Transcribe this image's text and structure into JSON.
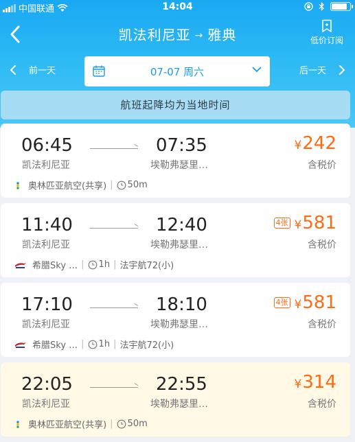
{
  "status": {
    "carrier": "中国联通",
    "time": "14:04"
  },
  "nav": {
    "from": "凯法利尼亚",
    "arrow": "→",
    "to": "雅典",
    "subscribe_label": "低价订阅"
  },
  "date_bar": {
    "prev_label": "前一天",
    "next_label": "后一天",
    "current_date": "07-07 周六"
  },
  "notice": "航班起降均为当地时间",
  "flights": [
    {
      "dep_time": "06:45",
      "arr_time": "07:35",
      "dep_city": "凯法利尼亚",
      "arr_city": "埃勒弗瑟里…",
      "price": "242",
      "currency": "¥",
      "tax_note": "含税价",
      "seats_left": "",
      "airline": "奥林匹亚航空(共享)",
      "duration": "50m",
      "aircraft": "",
      "logo": "olympic-logo"
    },
    {
      "dep_time": "11:40",
      "arr_time": "12:40",
      "dep_city": "凯法利尼亚",
      "arr_city": "埃勒弗瑟里…",
      "price": "581",
      "currency": "¥",
      "tax_note": "含税价",
      "seats_left": "4张",
      "airline": "希腊Sky …",
      "duration": "1h",
      "aircraft": "法宇航72(小)",
      "logo": "skyexpress-logo"
    },
    {
      "dep_time": "17:10",
      "arr_time": "18:10",
      "dep_city": "凯法利尼亚",
      "arr_city": "埃勒弗瑟里…",
      "price": "581",
      "currency": "¥",
      "tax_note": "含税价",
      "seats_left": "4张",
      "airline": "希腊Sky …",
      "duration": "1h",
      "aircraft": "法宇航72(小)",
      "logo": "skyexpress-logo"
    },
    {
      "dep_time": "22:05",
      "arr_time": "22:55",
      "dep_city": "凯法利尼亚",
      "arr_city": "埃勒弗瑟里…",
      "price": "314",
      "currency": "¥",
      "tax_note": "含税价",
      "seats_left": "",
      "airline": "奥林匹亚航空(共享)",
      "duration": "50m",
      "aircraft": "",
      "logo": "olympic-logo"
    }
  ],
  "colors": {
    "header_top": "#1aa8f3",
    "header_bottom": "#4cc8f6",
    "price": "#ff6a12",
    "date_text": "#1a9be6",
    "highlight_card": "#fff9e6"
  }
}
